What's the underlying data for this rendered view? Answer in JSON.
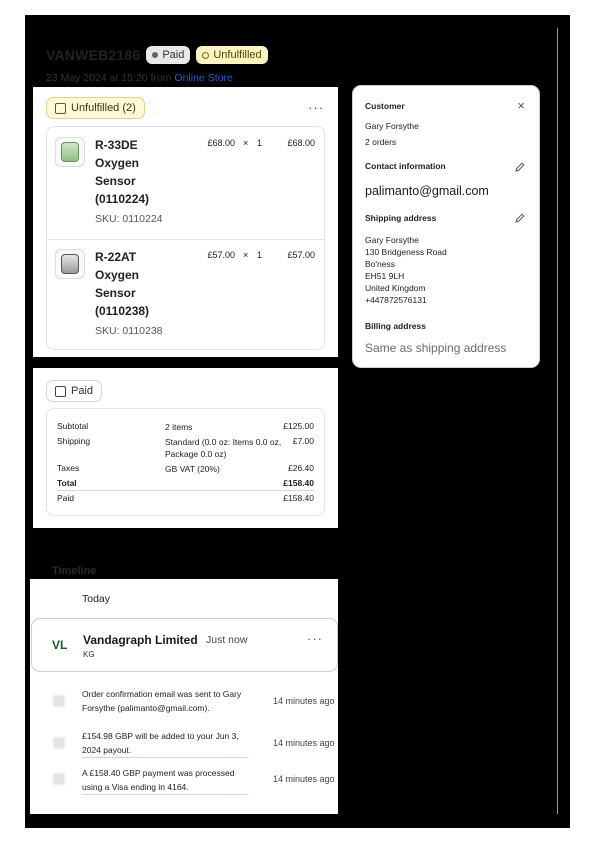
{
  "order": {
    "id": "VANWEB2186",
    "payment_badge": "Paid",
    "fulfillment_badge": "Unfulfilled",
    "date_prefix": "23 May 2024 at 15:20 from",
    "channel_link": "Online Store",
    "colors": {
      "unfulfilled_badge_bg": "#fff3c2",
      "paid_badge_bg": "#e8e8e8",
      "link": "#1f5fd6"
    }
  },
  "fulfillment": {
    "status_chip": "Unfulfilled (2)",
    "status_icon": "package-icon",
    "more_icon": "···",
    "items": [
      {
        "title": "R-33DE Oxygen Sensor (0110224)",
        "sku": "SKU: 0110224",
        "unit_price": "£68.00",
        "times": "×",
        "quantity": "1",
        "line_total": "£68.00"
      },
      {
        "title": "R-22AT Oxygen Sensor (0110238)",
        "sku": "SKU: 0110238",
        "unit_price": "£57.00",
        "times": "×",
        "quantity": "1",
        "line_total": "£57.00"
      }
    ]
  },
  "payment": {
    "status_chip": "Paid",
    "status_icon": "receipt-icon",
    "rows": [
      {
        "label": "Subtotal",
        "detail": "2 items",
        "amount": "£125.00"
      },
      {
        "label": "Shipping",
        "detail": "Standard (0.0 oz: Items 0.0 oz, Package 0.0 oz)",
        "amount": "£7.00"
      },
      {
        "label": "Taxes",
        "detail": "GB VAT (20%)",
        "amount": "£26.40"
      },
      {
        "label": "Total",
        "detail": "",
        "amount": "£158.40"
      },
      {
        "label": "Paid",
        "detail": "",
        "amount": "£158.40"
      }
    ]
  },
  "customer": {
    "heading": "Customer",
    "close_icon": "×",
    "name": "Gary Forsythe",
    "orders": "2 orders",
    "contact_heading": "Contact information",
    "email": "palimanto@gmail.com",
    "shipping_heading": "Shipping address",
    "address_lines": [
      "Gary Forsythe",
      "130 Bridgeness Road",
      "Bo'ness",
      "EH51 9LH",
      "United Kingdom",
      "+447872576131"
    ],
    "billing_heading": "Billing address",
    "billing_value": "Same as shipping address"
  },
  "timeline": {
    "label": "Timeline",
    "day": "Today",
    "comment": {
      "avatar": "VL",
      "author": "Vandagraph Limited",
      "time": "Just now",
      "body": "KG",
      "more_icon": "···"
    },
    "events": [
      {
        "text": "Order confirmation email was sent to Gary Forsythe (palimanto@gmail.com).",
        "time": "14 minutes ago"
      },
      {
        "text": "£154.98 GBP will be added to your Jun 3, 2024 payout.",
        "time": "14 minutes ago"
      },
      {
        "text": "A £158.40 GBP payment was processed using a Visa ending in 4164.",
        "time": "14 minutes ago"
      }
    ]
  }
}
